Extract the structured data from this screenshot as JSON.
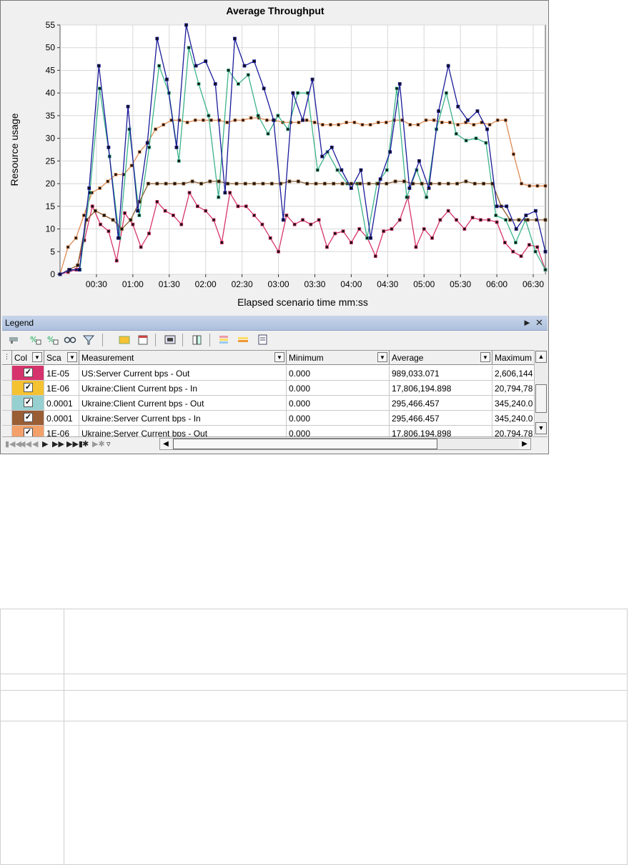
{
  "chart": {
    "title": "Average Throughput",
    "xlabel": "Elapsed scenario time mm:ss",
    "ylabel": "Resource usage",
    "y_ticks": [
      "0",
      "5",
      "10",
      "15",
      "20",
      "25",
      "30",
      "35",
      "40",
      "45",
      "50",
      "55"
    ],
    "x_ticks": [
      "00:30",
      "01:00",
      "01:30",
      "02:00",
      "02:30",
      "03:00",
      "03:30",
      "04:00",
      "04:30",
      "05:00",
      "05:30",
      "06:00",
      "06:30"
    ]
  },
  "chart_data": {
    "type": "line",
    "title": "Average Throughput",
    "xlabel": "Elapsed scenario time mm:ss",
    "ylabel": "Resource usage",
    "ylim": [
      0,
      55
    ],
    "xlim_seconds": [
      0,
      400
    ],
    "grid": true,
    "x_seconds": [
      0,
      10,
      15,
      20,
      25,
      30,
      35,
      40,
      45,
      50,
      55,
      60,
      65,
      70,
      75,
      80,
      85,
      90,
      95,
      100,
      105,
      110,
      115,
      120,
      125,
      130,
      135,
      140,
      145,
      150,
      155,
      160,
      165,
      170,
      175,
      180,
      185,
      190,
      195,
      200,
      205,
      210,
      215,
      220,
      225,
      230,
      235,
      240,
      245,
      250,
      255,
      260,
      265,
      270,
      275,
      280,
      285,
      290,
      295,
      300,
      305,
      310,
      315,
      320,
      325,
      330,
      335,
      340,
      345,
      350,
      355,
      360,
      365,
      370,
      375,
      380,
      385,
      390,
      395,
      400
    ],
    "series": [
      {
        "name": "US:Server Current bps - Out",
        "color": "#d6336c",
        "values": [
          0,
          0.5,
          1,
          7.5,
          15,
          11,
          9.5,
          3,
          13.5,
          11,
          6,
          9,
          16,
          14,
          13,
          11,
          18,
          15,
          14,
          12,
          7,
          18,
          15,
          15,
          13,
          11,
          8,
          5,
          13,
          11,
          12,
          11,
          12,
          6,
          9,
          9.5,
          7,
          10,
          8,
          4,
          9.5,
          10,
          12,
          17,
          6,
          10,
          8,
          12,
          14,
          12,
          10,
          12.5,
          12,
          12,
          11.5,
          7,
          5,
          4,
          6.5,
          6,
          1
        ]
      },
      {
        "name": "Ukraine:Client Current bps - In",
        "color": "#e08a52",
        "values": [
          0,
          6,
          8,
          13,
          18,
          19,
          20.5,
          22,
          22,
          24,
          27,
          29,
          32,
          33,
          34,
          34,
          33.5,
          34,
          34,
          34,
          34,
          33.5,
          34,
          34,
          34.5,
          34.5,
          34,
          34,
          33.5,
          33.5,
          33.5,
          34,
          33.5,
          33,
          33,
          33,
          33.5,
          33.5,
          33,
          33,
          33.5,
          33.5,
          34,
          34,
          33,
          33,
          34,
          34,
          33.5,
          33.5,
          33,
          33.5,
          33,
          33.5,
          33,
          34,
          34,
          26.5,
          20,
          19.5,
          19.5,
          19.5
        ]
      },
      {
        "name": "Ukraine:Client Current bps - Out",
        "color": "#3cb38a",
        "values": [
          0,
          1,
          1,
          18,
          41,
          26,
          8,
          32,
          13,
          28,
          46,
          40,
          25,
          50,
          42,
          35,
          17,
          45,
          42,
          44,
          35,
          31,
          35,
          32,
          40,
          40,
          23,
          27,
          23,
          20,
          20,
          8,
          20,
          23,
          41,
          17,
          23,
          17,
          32,
          40,
          31,
          29.5,
          30,
          29,
          13,
          12,
          7,
          12,
          5,
          1
        ]
      },
      {
        "name": "Ukraine:Server Current bps - In",
        "color": "#8b5a2b",
        "values": [
          0,
          1,
          2,
          12,
          14,
          13,
          12,
          10,
          12,
          16,
          20,
          20,
          20,
          20,
          20,
          20.5,
          20,
          20.5,
          20.5,
          20,
          20,
          20,
          20,
          20,
          20,
          20,
          20.5,
          20.5,
          20,
          20,
          20,
          20,
          20,
          20,
          20,
          20,
          20,
          20,
          20.5,
          20.5,
          20,
          20,
          20,
          20,
          20,
          20,
          20.5,
          20,
          20,
          20,
          15,
          12,
          12,
          12,
          12,
          12
        ]
      },
      {
        "name": "US:Server Current bps - In",
        "color": "#1a1a9a",
        "values": [
          0,
          1,
          1,
          19,
          46,
          28,
          8,
          37,
          14,
          29,
          52,
          43,
          28,
          55,
          46,
          47,
          42,
          18,
          52,
          46,
          47,
          41,
          34,
          12,
          40,
          34,
          43,
          26,
          28,
          23,
          19,
          23,
          8,
          21,
          27,
          42,
          19,
          25,
          19,
          36,
          46,
          37,
          34,
          36,
          32,
          15,
          15,
          10,
          13,
          14,
          5
        ]
      }
    ]
  },
  "legend": {
    "title": "Legend",
    "pin_icon": "pin-icon",
    "close_icon": "close-icon",
    "columns": [
      "Col",
      "Sca",
      "Measurement",
      "Minimum",
      "Average",
      "Maximum"
    ],
    "rows": [
      {
        "color": "#d6336c",
        "scale": "1E-05",
        "measurement": "US:Server Current bps - Out",
        "minimum": "0.000",
        "average": "989,033.071",
        "maximum": "2,606,144"
      },
      {
        "color": "#f5c232",
        "scale": "1E-06",
        "measurement": "Ukraine:Client Current bps - In",
        "minimum": "0.000",
        "average": "17,806,194.898",
        "maximum": "20,794,78"
      },
      {
        "color": "#96d0d0",
        "scale": "0.0001",
        "measurement": "Ukraine:Client Current bps - Out",
        "minimum": "0.000",
        "average": "295,466.457",
        "maximum": "345,240.0"
      },
      {
        "color": "#9a5e35",
        "scale": "0.0001",
        "measurement": "Ukraine:Server Current bps - In",
        "minimum": "0.000",
        "average": "295,466.457",
        "maximum": "345,240.0"
      },
      {
        "color": "#f4a06a",
        "scale": "1E-06",
        "measurement": "Ukraine:Server Current bps - Out",
        "minimum": "0.000",
        "average": "17,806,194.898",
        "maximum": "20,794,78"
      }
    ]
  }
}
